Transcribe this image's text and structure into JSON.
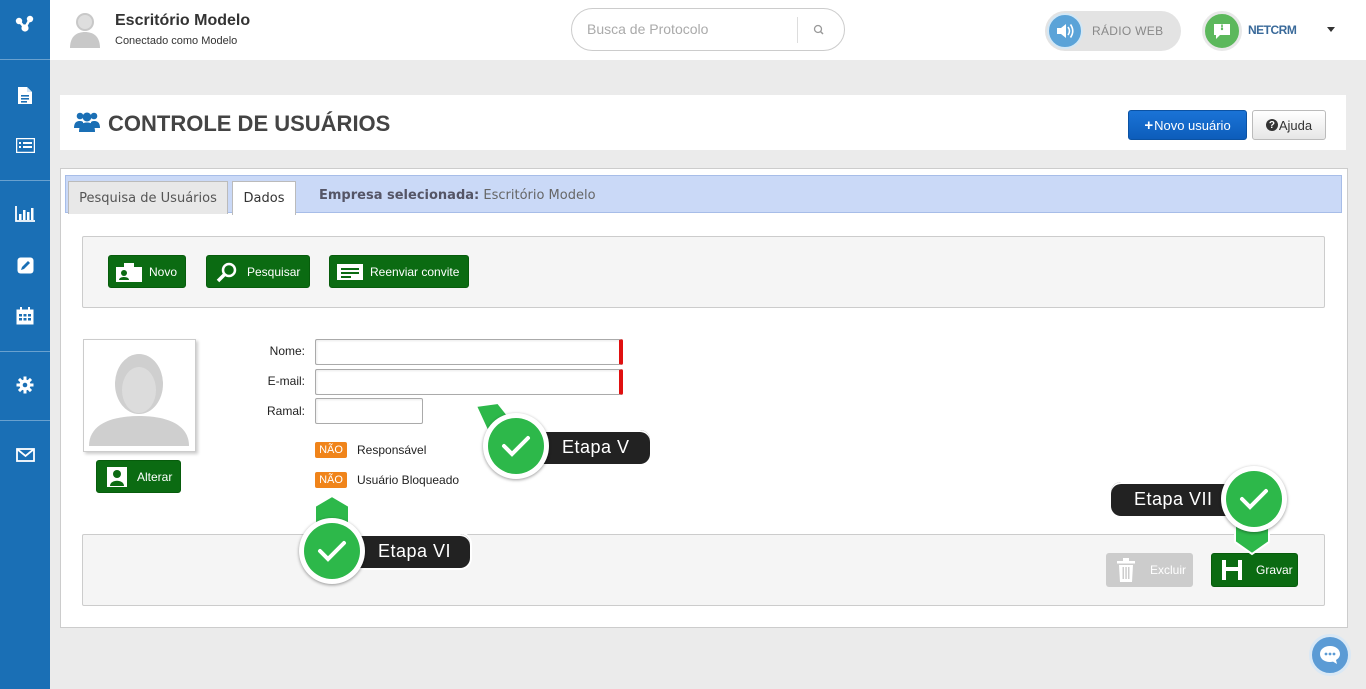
{
  "header": {
    "title": "Escritório Modelo",
    "subtitle": "Conectado como Modelo",
    "search_placeholder": "Busca de Protocolo",
    "radio_label": "RÁDIO WEB",
    "brand_label": "NETCRM"
  },
  "sidebar": {
    "items": [
      "logo-icon",
      "document-icon",
      "list-icon",
      "chart-icon",
      "edit-icon",
      "calendar-icon",
      "gear-icon",
      "mail-icon"
    ]
  },
  "page": {
    "title": "CONTROLE DE USUÁRIOS",
    "new_user_button": "Novo usuário",
    "help_button": "Ajuda"
  },
  "tabs": {
    "items": [
      {
        "label": "Pesquisa de Usuários"
      },
      {
        "label": "Dados"
      }
    ],
    "company_prefix": "Empresa selecionada:",
    "company_name": "Escritório Modelo"
  },
  "toolbar": {
    "novo": "Novo",
    "pesquisar": "Pesquisar",
    "reenviar": "Reenviar convite"
  },
  "form": {
    "photo_button": "Alterar",
    "nome_label": "Nome:",
    "email_label": "E-mail:",
    "ramal_label": "Ramal:",
    "nome_value": "",
    "email_value": "",
    "ramal_value": "",
    "responsavel_badge": "NÃO",
    "responsavel_label": "Responsável",
    "bloqueado_badge": "NÃO",
    "bloqueado_label": "Usuário Bloqueado"
  },
  "footer": {
    "excluir": "Excluir",
    "gravar": "Gravar"
  },
  "callouts": {
    "etapa_v": "Etapa V",
    "etapa_vi": "Etapa VI",
    "etapa_vii": "Etapa VII"
  },
  "colors": {
    "sidebar": "#1a6fb5",
    "green_button": "#0b6b12",
    "primary_button": "#1a73d6",
    "badge": "#f0841a",
    "tab_bar": "#cad9f7",
    "check": "#2db84a"
  }
}
